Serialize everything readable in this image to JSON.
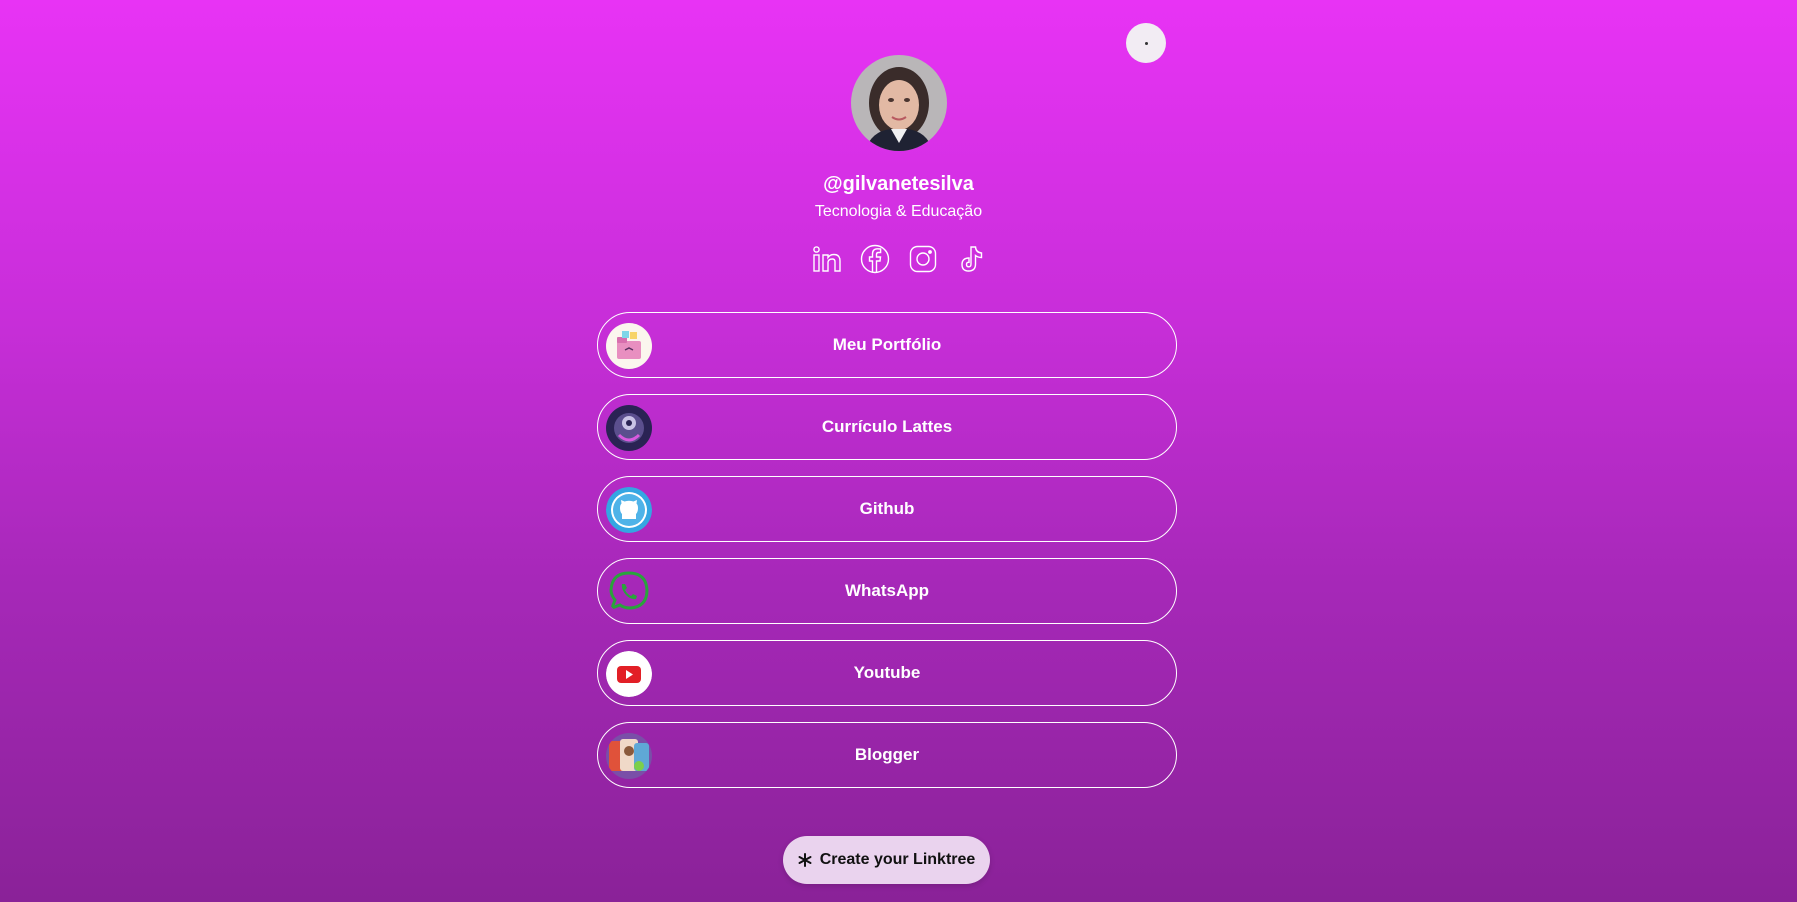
{
  "header": {
    "menu_icon": "more-dots-icon"
  },
  "profile": {
    "handle": "@gilvanetesilva",
    "bio": "Tecnologia & Educação",
    "avatar_icon": "profile-photo"
  },
  "socials": [
    {
      "name": "linkedin-icon"
    },
    {
      "name": "facebook-icon"
    },
    {
      "name": "instagram-icon"
    },
    {
      "name": "tiktok-icon"
    }
  ],
  "links": [
    {
      "label": "Meu Portfólio",
      "thumb": "portfolio-thumb"
    },
    {
      "label": "Currículo Lattes",
      "thumb": "lattes-thumb"
    },
    {
      "label": "Github",
      "thumb": "github-thumb"
    },
    {
      "label": "WhatsApp",
      "thumb": "whatsapp-thumb"
    },
    {
      "label": "Youtube",
      "thumb": "youtube-thumb"
    },
    {
      "label": "Blogger",
      "thumb": "blogger-thumb"
    }
  ],
  "cta": {
    "label": "Create your Linktree",
    "icon": "linktree-asterisk-icon"
  },
  "colors": {
    "gradient_top": "#e833f5",
    "gradient_bottom": "#8a2298",
    "button_border": "#ffffff",
    "cta_bg": "#ead3ee"
  }
}
